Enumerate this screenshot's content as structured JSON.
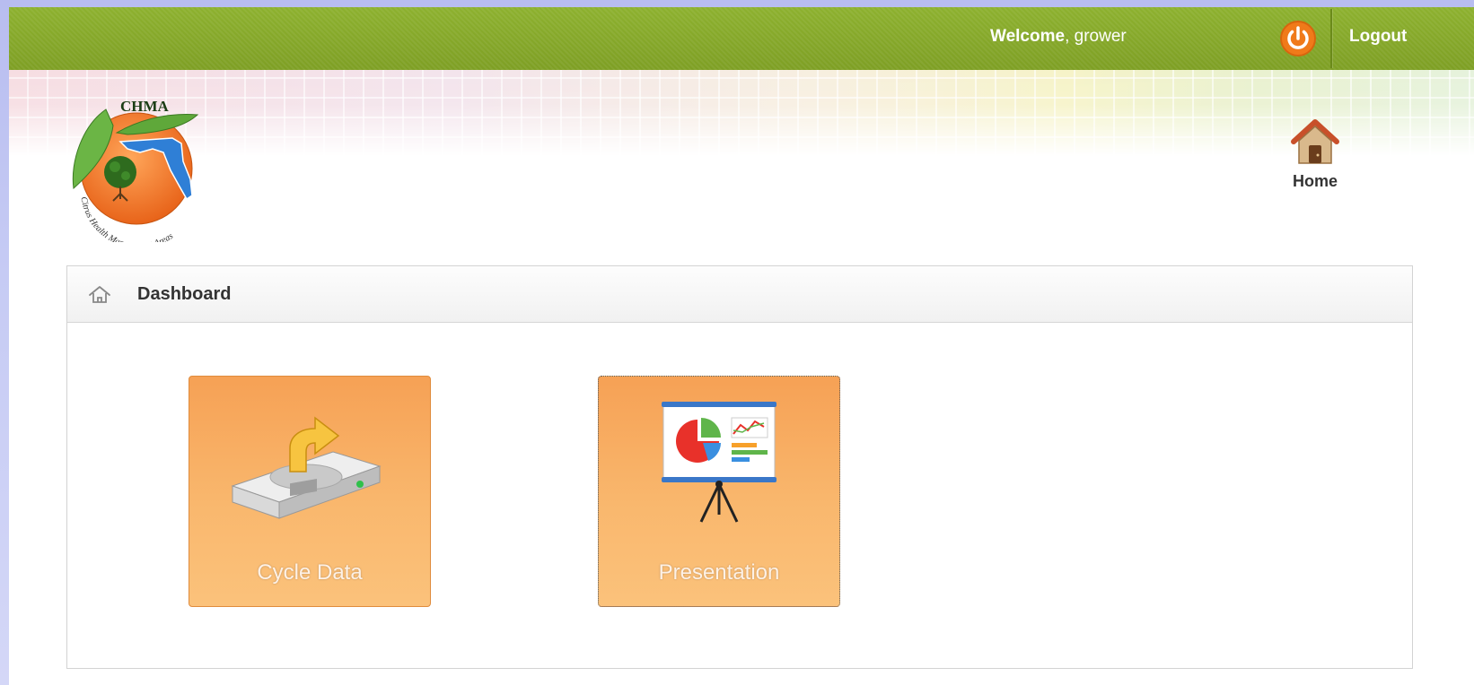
{
  "header": {
    "welcome_prefix": "Welcome",
    "welcome_suffix": ", grower",
    "logout_label": "Logout"
  },
  "logo": {
    "abbreviation": "CHMA",
    "subtitle": "Citrus Health Management Areas"
  },
  "nav": {
    "home_label": "Home"
  },
  "panel": {
    "title": "Dashboard",
    "tiles": [
      {
        "label": "Cycle Data",
        "icon": "hard-drive-upload-icon"
      },
      {
        "label": "Presentation",
        "icon": "presentation-board-icon"
      }
    ]
  },
  "colors": {
    "topbar": "#86a82a",
    "tile_orange": "#f9b76d",
    "power_orange": "#f07a1a"
  }
}
